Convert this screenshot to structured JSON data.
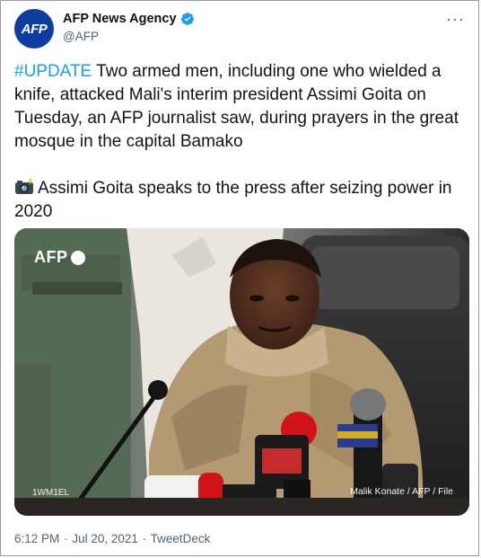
{
  "account": {
    "display_name": "AFP News Agency",
    "handle": "@AFP",
    "avatar_text": "AFP",
    "verified": true
  },
  "tweet": {
    "hashtag": "#UPDATE",
    "text_main": " Two armed men, including one who wielded a knife, attacked Mali's interim president Assimi Goita on Tuesday, an AFP journalist saw, during prayers in the great mosque in the capital Bamako",
    "text_caption": "Assimi Goita speaks to the press after seizing power in 2020",
    "caption_icon": "camera-with-flash-icon"
  },
  "media": {
    "watermark_logo": "AFP",
    "watermark_tag": "1WM1EL",
    "credit": "Malik Konate / AFP / File"
  },
  "meta": {
    "time": "6:12 PM",
    "date": "Jul 20, 2021",
    "source": "TweetDeck",
    "separator": "·"
  },
  "colors": {
    "link": "#1d9bf0",
    "avatar_bg": "#0f3d9f",
    "secondary_text": "#536471"
  }
}
